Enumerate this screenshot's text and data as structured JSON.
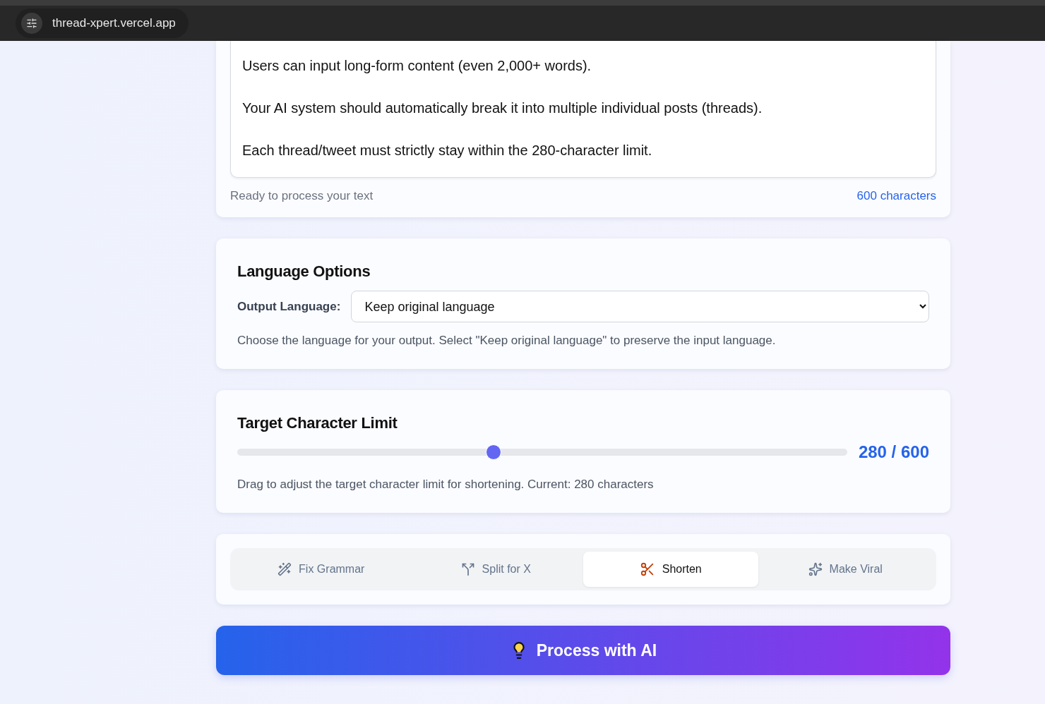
{
  "browser": {
    "url": "thread-xpert.vercel.app"
  },
  "input_card": {
    "text": "Users can input long-form content (even 2,000+ words).\n\nYour AI system should automatically break it into multiple individual posts (threads).\n\nEach thread/tweet must strictly stay within the 280-character limit.",
    "status": "Ready to process your text",
    "count": "600 characters"
  },
  "language_card": {
    "title": "Language Options",
    "label": "Output Language:",
    "value": "Keep original language",
    "help": "Choose the language for your output. Select \"Keep original language\" to preserve the input language."
  },
  "limit_card": {
    "title": "Target Character Limit",
    "level": 0.42,
    "reading": "280 / 600",
    "help": "Drag to adjust the target character limit for shortening. Current: 280 characters"
  },
  "modes": [
    {
      "kind": "grammar",
      "label": "Fix Grammar",
      "selected": false
    },
    {
      "kind": "split",
      "label": "Split for X",
      "selected": false
    },
    {
      "kind": "shorten",
      "label": "Shorten",
      "selected": true
    },
    {
      "kind": "viral",
      "label": "Make Viral",
      "selected": false
    }
  ],
  "process_button": {
    "label": "Process with AI"
  }
}
